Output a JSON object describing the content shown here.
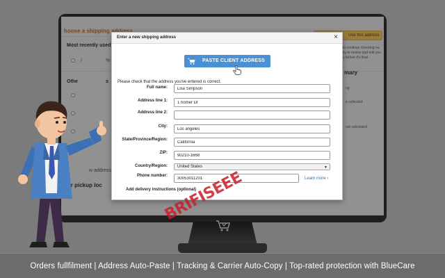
{
  "background_page": {
    "heading": "hoose a shipping address",
    "recent_label": "Most recently used",
    "use_address_button": "Use this address",
    "other_label": "Othe",
    "pickup_label": "our pickup loc",
    "new_address_hint": "w address",
    "summary_label": "mary",
    "side_text_1": "to continue checking ou",
    "side_text_2": "ity to review and edit you",
    "side_text_3": "s before it's final.",
    "side_text_4": "ng",
    "side_text_5": "e collected:",
    "side_text_6": "not calculated"
  },
  "modal": {
    "title": "Enter a new shipping address",
    "close_symbol": "×",
    "paste_button": "PASTE CLIENT ADDRESS",
    "check_note": "Please check that the address you've entered is correct.",
    "fields": {
      "full_name": {
        "label": "Full name:",
        "value": "Lisa Simpson"
      },
      "address1": {
        "label": "Address line 1:",
        "value": "1 homer Dr"
      },
      "address2": {
        "label": "Address line 2:",
        "value": ""
      },
      "city": {
        "label": "City:",
        "value": "Los angeles"
      },
      "state": {
        "label": "State/Province/Region:",
        "value": "California"
      },
      "zip": {
        "label": "ZIP:",
        "value": "90210-1668"
      },
      "country": {
        "label": "Country/Region:",
        "value": "United States"
      },
      "phone": {
        "label": "Phone number:",
        "value": "30053011201"
      }
    },
    "learn_more": "Learn more ›",
    "delivery_instructions": "Add delivery instructions (optional)"
  },
  "watermark": "BRIFISEEE",
  "footer": {
    "text": "Orders fullfilment | Address Auto-Paste | Tracking & Carrier Auto-Copy | Top-rated protection with BlueCare"
  },
  "colors": {
    "background": "#7b7b7b",
    "paste_button": "#4990d4",
    "link": "#2e6db0",
    "watermark": "#c81e28"
  }
}
